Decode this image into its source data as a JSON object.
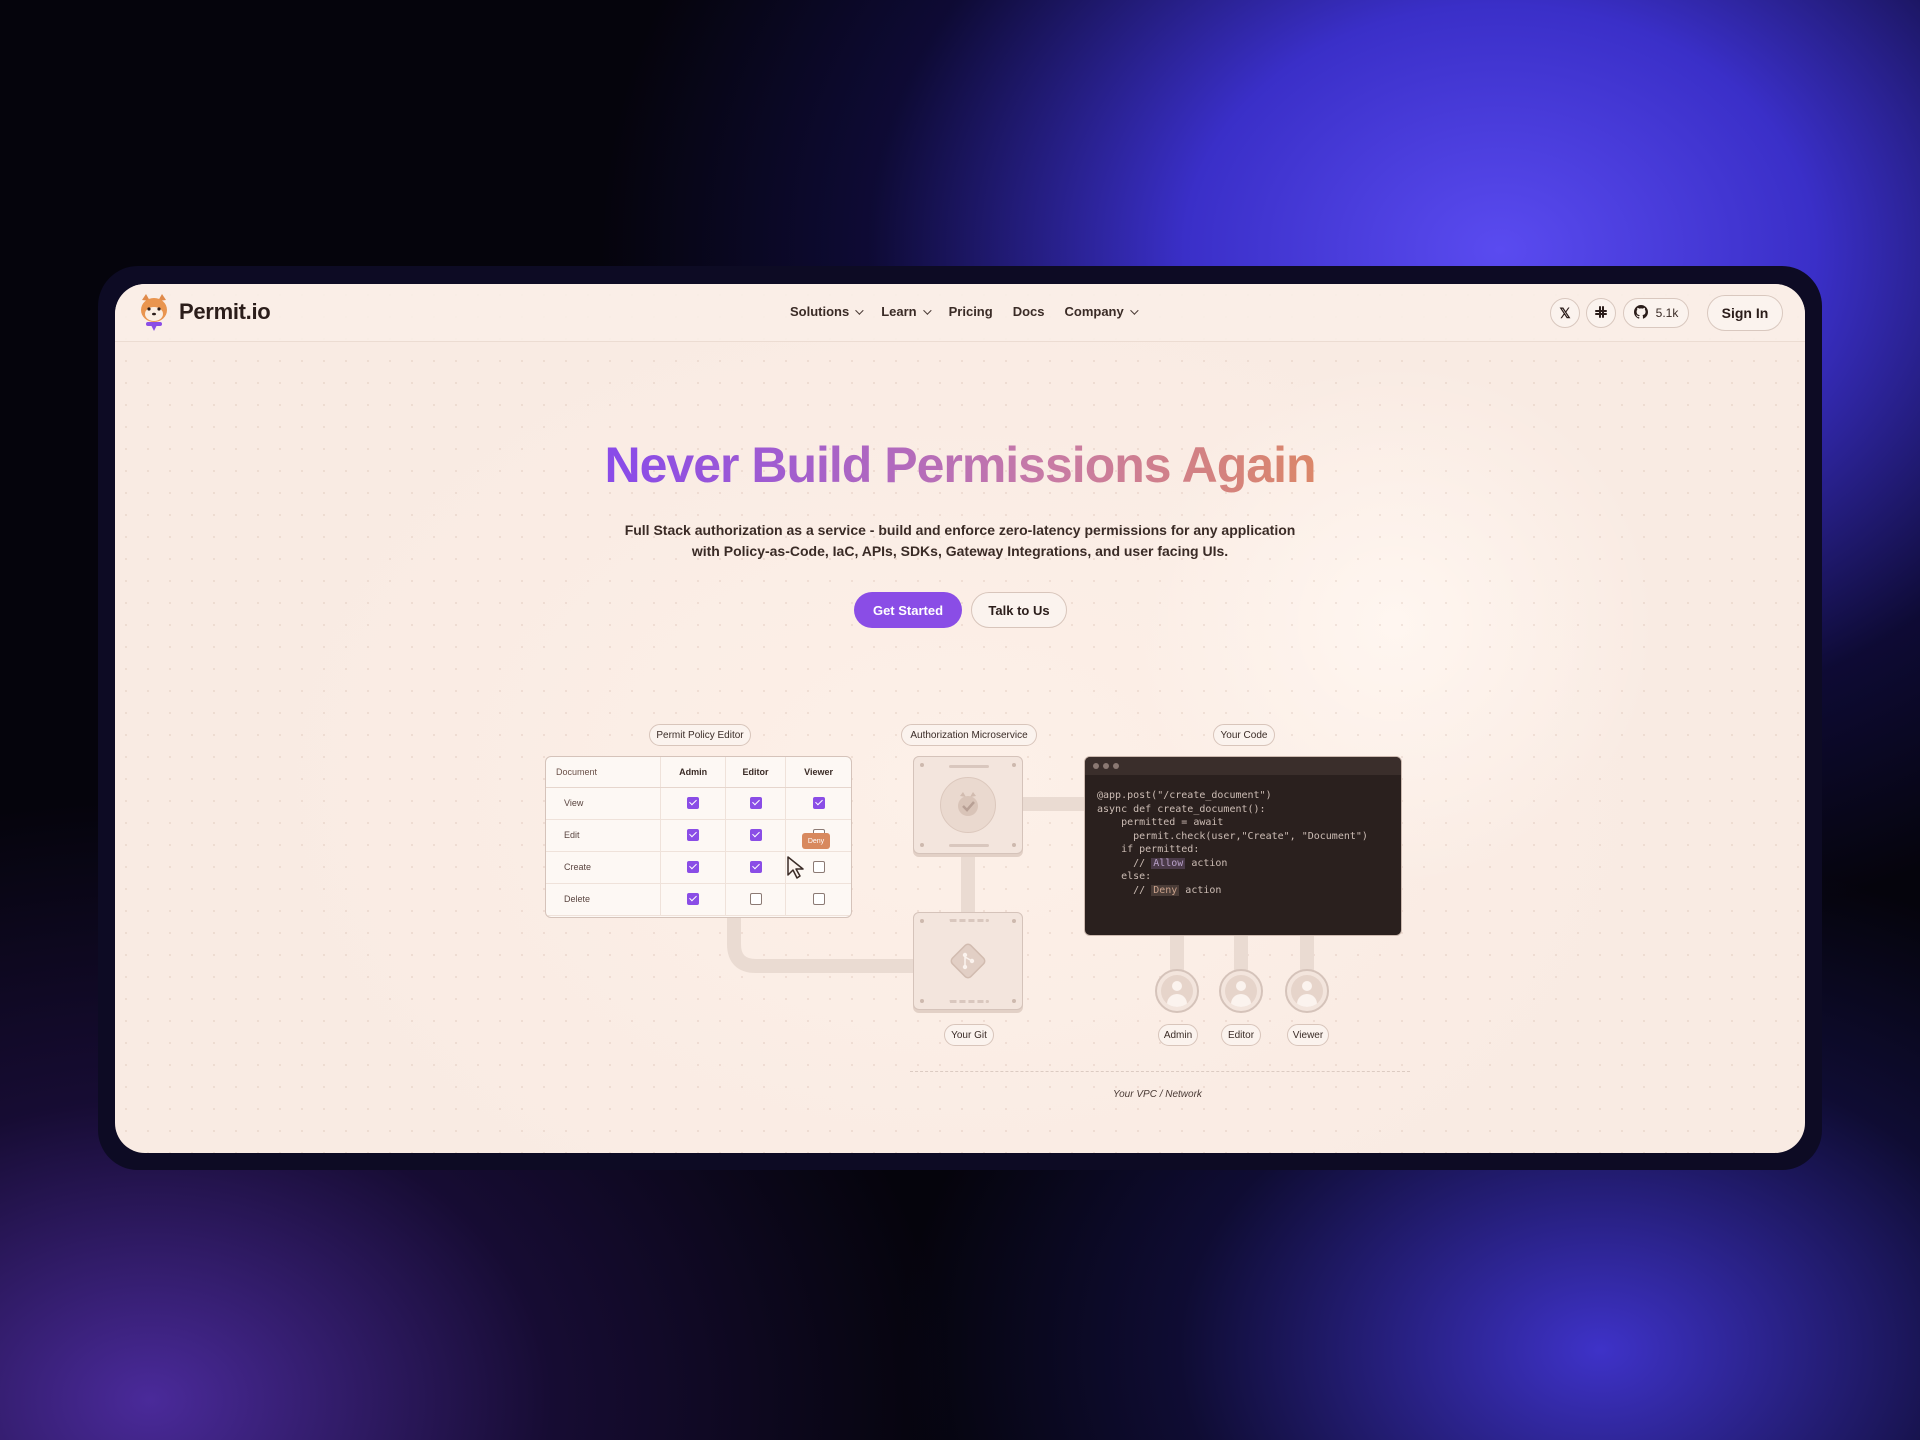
{
  "brand": {
    "name": "Permit.io"
  },
  "nav": {
    "menu": [
      {
        "label": "Solutions",
        "dropdown": true
      },
      {
        "label": "Learn",
        "dropdown": true
      },
      {
        "label": "Pricing",
        "dropdown": false
      },
      {
        "label": "Docs",
        "dropdown": false
      },
      {
        "label": "Company",
        "dropdown": true
      }
    ],
    "social": [
      "x-icon",
      "slack-icon"
    ],
    "github_stars": "5.1k",
    "signin_label": "Sign In"
  },
  "hero": {
    "title": "Never Build Permissions Again",
    "subtitle_line1": "Full Stack authorization as a service - build and enforce zero-latency permissions for any application",
    "subtitle_line2": "with Policy-as-Code, IaC, APIs, SDKs, Gateway Integrations, and user facing UIs.",
    "primary_cta": "Get Started",
    "secondary_cta": "Talk to Us"
  },
  "diagram": {
    "labels": {
      "policy_editor": "Permit Policy Editor",
      "microservice": "Authorization Microservice",
      "your_code": "Your Code",
      "your_git": "Your Git",
      "vpc": "Your VPC / Network"
    },
    "policy_table": {
      "headers": [
        "Document",
        "Admin",
        "Editor",
        "Viewer"
      ],
      "rows": [
        {
          "label": "View",
          "admin": true,
          "editor": true,
          "viewer": true
        },
        {
          "label": "Edit",
          "admin": true,
          "editor": true,
          "viewer": false
        },
        {
          "label": "Create",
          "admin": true,
          "editor": true,
          "viewer": false
        },
        {
          "label": "Delete",
          "admin": true,
          "editor": false,
          "viewer": false
        }
      ],
      "deny_tag": "Deny"
    },
    "code_lines": [
      "@app.post(\"/create_document\")",
      "async def create_document():",
      "    permitted = await",
      "      permit.check(user,\"Create\", \"Document\")",
      "    if permitted:",
      "      // ",
      "    else:",
      "      // "
    ],
    "code_allow": "Allow",
    "code_deny": "Deny",
    "code_action": " action",
    "roles": [
      "Admin",
      "Editor",
      "Viewer"
    ]
  }
}
